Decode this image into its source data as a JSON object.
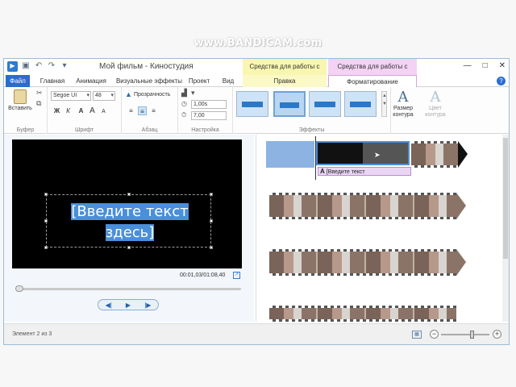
{
  "watermark": "www.BANDICAM.com",
  "window": {
    "title": "Мой фильм - Киностудия",
    "minimize": "—",
    "maximize": "□",
    "close": "✕"
  },
  "context_groups": {
    "video_tools": "Средства для работы с видео",
    "text_tools": "Средства для работы с текстом"
  },
  "tabs": {
    "file": "Файл",
    "home": "Главная",
    "animation": "Анимация",
    "visual_effects": "Визуальные эффекты",
    "project": "Проект",
    "view": "Вид",
    "edit": "Правка",
    "format": "Форматирование",
    "help": "?"
  },
  "ribbon": {
    "clipboard": {
      "paste_label": "Вставить",
      "group_label": "Буфер"
    },
    "font": {
      "family": "Segoe UI",
      "size": "48",
      "bold": "Ж",
      "italic": "К",
      "font_color": "A",
      "grow": "A",
      "shrink": "A",
      "group_label": "Шрифт"
    },
    "paragraph": {
      "transparency_label": "Прозрачность",
      "group_label": "Абзац"
    },
    "adjust": {
      "start_time": "1,00s",
      "duration": "7,00",
      "group_label": "Настройка"
    },
    "effects": {
      "group_label": "Эффекты"
    },
    "outline_size": {
      "label1": "Размер",
      "label2": "контура"
    },
    "outline_color": {
      "label1": "Цвет",
      "label2": "контура"
    }
  },
  "preview": {
    "caption_line1": "[Введите текст",
    "caption_line2": "здесь]",
    "timecode": "00:01,03/01:08,40"
  },
  "storyboard": {
    "text_clip": "[Введите текст"
  },
  "status": {
    "item_text": "Элемент 2 из 3",
    "zoom_minus": "−",
    "zoom_plus": "+"
  }
}
